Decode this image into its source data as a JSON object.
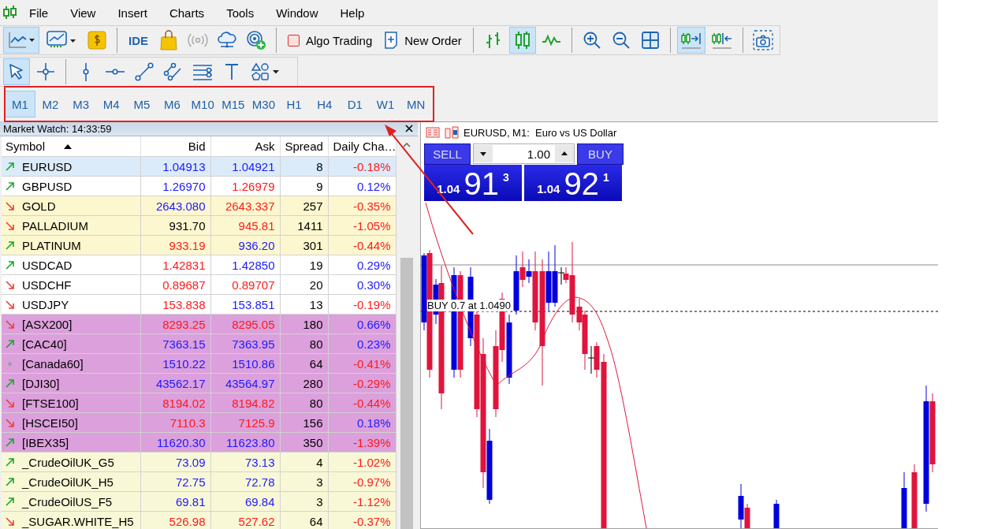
{
  "menu": [
    "File",
    "View",
    "Insert",
    "Charts",
    "Tools",
    "Window",
    "Help"
  ],
  "main_toolbar": {
    "chart_type_selected": true,
    "ide": "IDE",
    "algo_trading": {
      "label": "Algo Trading",
      "on": false
    },
    "new_order": "New Order",
    "candles_selected": true,
    "bars_selected": false,
    "line_selected": false,
    "autoscroll_selected": true,
    "chart_shift_selected": false
  },
  "drawing_tools": [
    {
      "selected": true
    },
    {
      "selected": false
    },
    {
      "selected": false
    },
    {
      "selected": false
    },
    {
      "selected": false
    },
    {
      "selected": false
    },
    {
      "selected": false
    },
    {
      "selected": false
    },
    {
      "selected": false
    }
  ],
  "timeframes": [
    {
      "label": "M1",
      "selected": true
    },
    {
      "label": "M2",
      "selected": false
    },
    {
      "label": "M3",
      "selected": false
    },
    {
      "label": "M4",
      "selected": false
    },
    {
      "label": "M5",
      "selected": false
    },
    {
      "label": "M6",
      "selected": false
    },
    {
      "label": "M10",
      "selected": false
    },
    {
      "label": "M15",
      "selected": false
    },
    {
      "label": "M30",
      "selected": false
    },
    {
      "label": "H1",
      "selected": false
    },
    {
      "label": "H4",
      "selected": false
    },
    {
      "label": "D1",
      "selected": false
    },
    {
      "label": "W1",
      "selected": false
    },
    {
      "label": "MN",
      "selected": false
    }
  ],
  "market_watch": {
    "title": "Market Watch: 14:33:59",
    "columns": [
      "Symbol",
      "Bid",
      "Ask",
      "Spread",
      "Daily Cha…"
    ],
    "rows": [
      {
        "symbol": "EURUSD",
        "kind": "rising",
        "bid": {
          "text": "1.04913",
          "color": "#1a1aff"
        },
        "ask": {
          "text": "1.04921",
          "color": "#1a1aff"
        },
        "spread": "8",
        "change": {
          "text": "-0.18%",
          "color": "#ff1a1a"
        },
        "selected": true
      },
      {
        "symbol": "GBPUSD",
        "kind": "rising",
        "bid": {
          "text": "1.26970",
          "color": "#1a1aff"
        },
        "ask": {
          "text": "1.26979",
          "color": "#ff1a1a"
        },
        "spread": "9",
        "change": {
          "text": "0.12%",
          "color": "#1a1aff"
        },
        "color": "#ffffff",
        "selected": false
      },
      {
        "symbol": "GOLD",
        "kind": "falling",
        "bid": {
          "text": "2643.080",
          "color": "#1a1aff"
        },
        "ask": {
          "text": "2643.337",
          "color": "#ff1a1a"
        },
        "spread": "257",
        "change": {
          "text": "-0.35%",
          "color": "#ff1a1a"
        },
        "color": "#fdf7cf",
        "selected": false
      },
      {
        "symbol": "PALLADIUM",
        "kind": "falling",
        "bid": {
          "text": "931.70",
          "color": "#000000"
        },
        "ask": {
          "text": "945.81",
          "color": "#ff1a1a"
        },
        "spread": "1411",
        "change": {
          "text": "-1.05%",
          "color": "#ff1a1a"
        },
        "color": "#fdf7cf",
        "selected": false
      },
      {
        "symbol": "PLATINUM",
        "kind": "rising",
        "bid": {
          "text": "933.19",
          "color": "#ff1a1a"
        },
        "ask": {
          "text": "936.20",
          "color": "#1a1aff"
        },
        "spread": "301",
        "change": {
          "text": "-0.44%",
          "color": "#ff1a1a"
        },
        "color": "#fdf7cf",
        "selected": false
      },
      {
        "symbol": "USDCAD",
        "kind": "rising",
        "bid": {
          "text": "1.42831",
          "color": "#ff1a1a"
        },
        "ask": {
          "text": "1.42850",
          "color": "#1a1aff"
        },
        "spread": "19",
        "change": {
          "text": "0.29%",
          "color": "#1a1aff"
        },
        "color": "#ffffff",
        "selected": false
      },
      {
        "symbol": "USDCHF",
        "kind": "falling",
        "bid": {
          "text": "0.89687",
          "color": "#ff1a1a"
        },
        "ask": {
          "text": "0.89707",
          "color": "#ff1a1a"
        },
        "spread": "20",
        "change": {
          "text": "0.30%",
          "color": "#1a1aff"
        },
        "color": "#ffffff",
        "selected": false
      },
      {
        "symbol": "USDJPY",
        "kind": "falling",
        "bid": {
          "text": "153.838",
          "color": "#ff1a1a"
        },
        "ask": {
          "text": "153.851",
          "color": "#1a1aff"
        },
        "spread": "13",
        "change": {
          "text": "-0.19%",
          "color": "#ff1a1a"
        },
        "color": "#ffffff",
        "selected": false
      },
      {
        "symbol": "[ASX200]",
        "kind": "falling",
        "bid": {
          "text": "8293.25",
          "color": "#ff1a1a"
        },
        "ask": {
          "text": "8295.05",
          "color": "#ff1a1a"
        },
        "spread": "180",
        "change": {
          "text": "0.66%",
          "color": "#1a1aff"
        },
        "color": "#dca0dc",
        "selected": false
      },
      {
        "symbol": "[CAC40]",
        "kind": "rising",
        "bid": {
          "text": "7363.15",
          "color": "#1a1aff"
        },
        "ask": {
          "text": "7363.95",
          "color": "#1a1aff"
        },
        "spread": "80",
        "change": {
          "text": "0.23%",
          "color": "#1a1aff"
        },
        "color": "#dca0dc",
        "selected": false
      },
      {
        "symbol": "[Canada60]",
        "kind": "unchanged",
        "bid": {
          "text": "1510.22",
          "color": "#1a1aff"
        },
        "ask": {
          "text": "1510.86",
          "color": "#1a1aff"
        },
        "spread": "64",
        "change": {
          "text": "-0.41%",
          "color": "#ff1a1a"
        },
        "color": "#dca0dc",
        "selected": false
      },
      {
        "symbol": "[DJI30]",
        "kind": "rising",
        "bid": {
          "text": "43562.17",
          "color": "#1a1aff"
        },
        "ask": {
          "text": "43564.97",
          "color": "#1a1aff"
        },
        "spread": "280",
        "change": {
          "text": "-0.29%",
          "color": "#ff1a1a"
        },
        "color": "#dca0dc",
        "selected": false
      },
      {
        "symbol": "[FTSE100]",
        "kind": "falling",
        "bid": {
          "text": "8194.02",
          "color": "#ff1a1a"
        },
        "ask": {
          "text": "8194.82",
          "color": "#ff1a1a"
        },
        "spread": "80",
        "change": {
          "text": "-0.44%",
          "color": "#ff1a1a"
        },
        "color": "#dca0dc",
        "selected": false
      },
      {
        "symbol": "[HSCEI50]",
        "kind": "falling",
        "bid": {
          "text": "7110.3",
          "color": "#ff1a1a"
        },
        "ask": {
          "text": "7125.9",
          "color": "#ff1a1a"
        },
        "spread": "156",
        "change": {
          "text": "0.18%",
          "color": "#1a1aff"
        },
        "color": "#dca0dc",
        "selected": false
      },
      {
        "symbol": "[IBEX35]",
        "kind": "rising",
        "bid": {
          "text": "11620.30",
          "color": "#1a1aff"
        },
        "ask": {
          "text": "11623.80",
          "color": "#1a1aff"
        },
        "spread": "350",
        "change": {
          "text": "-1.39%",
          "color": "#ff1a1a"
        },
        "color": "#dca0dc",
        "selected": false
      },
      {
        "symbol": "_CrudeOilUK_G5",
        "kind": "rising",
        "bid": {
          "text": "73.09",
          "color": "#1a1aff"
        },
        "ask": {
          "text": "73.13",
          "color": "#1a1aff"
        },
        "spread": "4",
        "change": {
          "text": "-1.02%",
          "color": "#ff1a1a"
        },
        "color": "#f8f8d6",
        "selected": false
      },
      {
        "symbol": "_CrudeOilUK_H5",
        "kind": "rising",
        "bid": {
          "text": "72.75",
          "color": "#1a1aff"
        },
        "ask": {
          "text": "72.78",
          "color": "#1a1aff"
        },
        "spread": "3",
        "change": {
          "text": "-0.97%",
          "color": "#ff1a1a"
        },
        "color": "#f8f8d6",
        "selected": false
      },
      {
        "symbol": "_CrudeOilUS_F5",
        "kind": "rising",
        "bid": {
          "text": "69.81",
          "color": "#1a1aff"
        },
        "ask": {
          "text": "69.84",
          "color": "#1a1aff"
        },
        "spread": "3",
        "change": {
          "text": "-1.12%",
          "color": "#ff1a1a"
        },
        "color": "#f8f8d6",
        "selected": false
      },
      {
        "symbol": "_SUGAR.WHITE_H5",
        "kind": "falling",
        "bid": {
          "text": "526.98",
          "color": "#ff1a1a"
        },
        "ask": {
          "text": "527.62",
          "color": "#ff1a1a"
        },
        "spread": "64",
        "change": {
          "text": "-0.37%",
          "color": "#ff1a1a"
        },
        "color": "#f8f8d6",
        "selected": false
      }
    ]
  },
  "chart": {
    "title": "EURUSD, M1:  Euro vs US Dollar",
    "sell": "SELL",
    "buy": "BUY",
    "volume": "1.00",
    "sell_price": {
      "big": "1.04",
      "main": "91",
      "small": "3"
    },
    "buy_price": {
      "big": "1.04",
      "main": "92",
      "small": "1"
    },
    "order_line": "BUY 0.7 at 1.0490"
  }
}
